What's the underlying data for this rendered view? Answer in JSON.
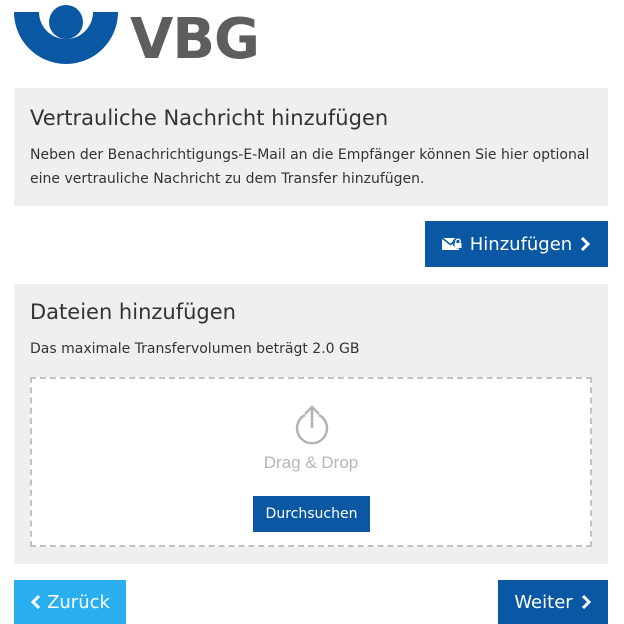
{
  "brand": {
    "logo_text": "VBG",
    "primary_color": "#0a57a3",
    "secondary_color": "#29aff0",
    "logo_text_color": "#5c5e60"
  },
  "message_section": {
    "title": "Vertrauliche Nachricht hinzufügen",
    "description": "Neben der Benachrichtigungs-E-Mail an die Empfänger können Sie hier optional eine vertrauliche Nachricht zu dem Transfer hinzufügen.",
    "add_button_label": "Hinzufügen",
    "add_button_icon": "envelope-lock-icon"
  },
  "files_section": {
    "title": "Dateien hinzufügen",
    "description": "Das maximale Transfervolumen beträgt 2.0 GB",
    "dropzone": {
      "icon": "upload-icon",
      "text": "Drag & Drop",
      "browse_button_label": "Durchsuchen"
    }
  },
  "navigation": {
    "back_label": "Zurück",
    "next_label": "Weiter"
  }
}
